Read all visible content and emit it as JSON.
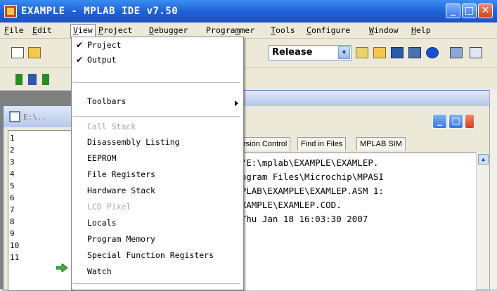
{
  "window": {
    "title": "EXAMPLE - MPLAB IDE v7.50"
  },
  "menubar": {
    "items": [
      {
        "label": "File",
        "u": "F",
        "rest": "ile"
      },
      {
        "label": "Edit",
        "u": "E",
        "rest": "dit"
      },
      {
        "label": "View",
        "u": "V",
        "rest": "iew"
      },
      {
        "label": "Project",
        "u": "P",
        "rest": "roject"
      },
      {
        "label": "Debugger",
        "u": "D",
        "rest": "ebugger"
      },
      {
        "label": "Programmer",
        "u": "",
        "pre": "Progra",
        "u2": "m",
        "rest": "mer"
      },
      {
        "label": "Tools",
        "u": "T",
        "rest": "ools"
      },
      {
        "label": "Configure",
        "u": "C",
        "rest": "onfigure"
      },
      {
        "label": "Window",
        "u": "W",
        "rest": "indow"
      },
      {
        "label": "Help",
        "u": "H",
        "rest": "elp"
      }
    ]
  },
  "toolbar": {
    "build_config": "Release"
  },
  "editor": {
    "title": "E:\\..",
    "line_numbers": [
      "1",
      "2",
      "3",
      "4",
      "5",
      "6",
      "7",
      "8",
      "9",
      "10",
      "11"
    ]
  },
  "output": {
    "title": "t",
    "tabs": [
      "rsion Control",
      "Find in Files",
      "MPLAB SIM"
    ],
    "lines": [
      "e target \"E:\\mplab\\EXAMPLE\\EXAMLEP.",
      "g: \"C:\\Program Files\\Microchip\\MPASI",
      "302] E:\\MPLAB\\EXAMPLE\\EXAMLEP.ASM 1:",
      ":\\mplab\\EXAMPLE\\EXAMLEP.COD.",
      "CCEEDED: Thu Jan 18 16:03:30 2007"
    ]
  },
  "view_menu": {
    "project": "Project",
    "output": "Output",
    "toolbars": "Toolbars",
    "call_stack": "Call Stack",
    "disassembly": "Disassembly Listing",
    "eeprom": "EEPROM",
    "file_registers": "File Registers",
    "hardware_stack": "Hardware Stack",
    "lcd_pixel": "LCD Pixel",
    "locals": "Locals",
    "program_memory": "Program Memory",
    "sfr": "Special Function Registers",
    "watch": "Watch"
  }
}
